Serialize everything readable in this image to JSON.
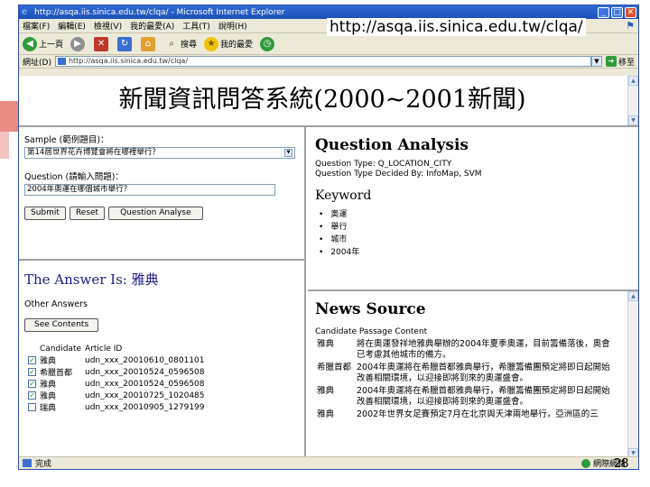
{
  "window": {
    "title": "http://asqa.iis.sinica.edu.tw/clqa/ - Microsoft Internet Explorer",
    "minimize": "_",
    "maximize": "□",
    "close": "✕"
  },
  "menubar": {
    "items": [
      "檔案(F)",
      "編輯(E)",
      "檢視(V)",
      "我的最愛(A)",
      "工具(T)",
      "說明(H)"
    ]
  },
  "url_caption": "http://asqa.iis.sinica.edu.tw/clqa/",
  "toolbar": {
    "back": "上一頁",
    "search": "搜尋",
    "favorites": "我的最愛"
  },
  "addressbar": {
    "label": "網址(D)",
    "value": "http://asqa.iis.sinica.edu.tw/clqa/",
    "go": "移至"
  },
  "page": {
    "title": "新聞資訊問答系統(2000~2001新聞)"
  },
  "form": {
    "sample_label": "Sample (範例題目)：",
    "sample_value": "第14屆世界花卉博覽會將在哪裡舉行？",
    "question_label": "Question (請輸入問題)：",
    "question_value": "2004年奧運在哪個城市舉行？",
    "submit": "Submit",
    "reset": "Reset",
    "analyse": "Question Analyse"
  },
  "answer": {
    "prefix": "The Answer Is:",
    "value": "雅典",
    "other_title": "Other Answers",
    "see_contents": "See Contents",
    "columns": [
      "Candidate",
      "Article ID"
    ],
    "rows": [
      {
        "checked": "✓",
        "candidate": "雅典",
        "article": "udn_xxx_20010610_0801101"
      },
      {
        "checked": "✓",
        "candidate": "希臘首都",
        "article": "udn_xxx_20010524_0596508"
      },
      {
        "checked": "✓",
        "candidate": "雅典",
        "article": "udn_xxx_20010524_0596508"
      },
      {
        "checked": "✓",
        "candidate": "雅典",
        "article": "udn_xxx_20010725_1020485"
      },
      {
        "checked": "",
        "candidate": "瑞典",
        "article": "udn_xxx_20010905_1279199"
      }
    ]
  },
  "analysis": {
    "title": "Question Analysis",
    "type_line": "Question Type: Q_LOCATION_CITY",
    "decided_line": "Question Type Decided By: InfoMap, SVM",
    "keyword_title": "Keyword",
    "keywords": [
      "奧運",
      "舉行",
      "城市",
      "2004年"
    ]
  },
  "news": {
    "title": "News Source",
    "header": "Candidate  Passage Content",
    "rows": [
      {
        "source": "雅典",
        "content": "將在奧運發祥地雅典舉辦的2004年夏季奧運，目前籌備落後，奧會已考慮其他城市的備方。"
      },
      {
        "source": "希臘首都",
        "content": "2004年奧運將在希臘首都雅典舉行，希臘籌備團預定將即日起開始改善相關環境，以迎接即將到來的奧運盛會。"
      },
      {
        "source": "雅典",
        "content": "2004年奧運將在希臘首都雅典舉行，希臘籌備團預定將即日起開始改善相關環境，以迎接即將到來的奧運盛會。"
      },
      {
        "source": "雅典",
        "content": "2002年世界女足賽預定7月在北京與天津兩地舉行，亞洲區的三"
      }
    ]
  },
  "status": {
    "text": "完成",
    "zone": "網際網路"
  },
  "slide_number": "28"
}
